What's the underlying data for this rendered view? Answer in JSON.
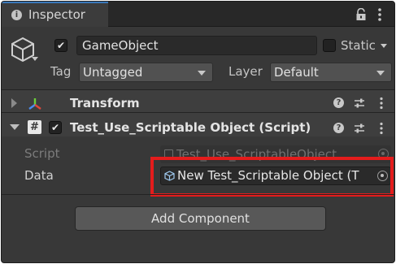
{
  "tab": {
    "title": "Inspector",
    "icon": "info-icon"
  },
  "gameobject": {
    "name": "GameObject",
    "active": true,
    "static_label": "Static",
    "static": false,
    "tag_label": "Tag",
    "tag_value": "Untagged",
    "layer_label": "Layer",
    "layer_value": "Default"
  },
  "components": [
    {
      "title": "Transform",
      "icon": "transform-axes-icon",
      "expanded": false
    },
    {
      "title": "Test_Use_Scriptable Object (Script)",
      "icon": "csharp-script-icon",
      "expanded": true,
      "enabled": true
    }
  ],
  "script_component": {
    "fields": [
      {
        "label": "Script",
        "value": "Test_Use_ScriptableObject",
        "disabled": true
      },
      {
        "label": "Data",
        "value": "New Test_Scriptable Object (T",
        "highlighted": true
      }
    ]
  },
  "add_component_label": "Add Component",
  "colors": {
    "highlight": "#e41c1c",
    "tab_accent": "#3a79bb",
    "panel_bg": "#383838"
  }
}
